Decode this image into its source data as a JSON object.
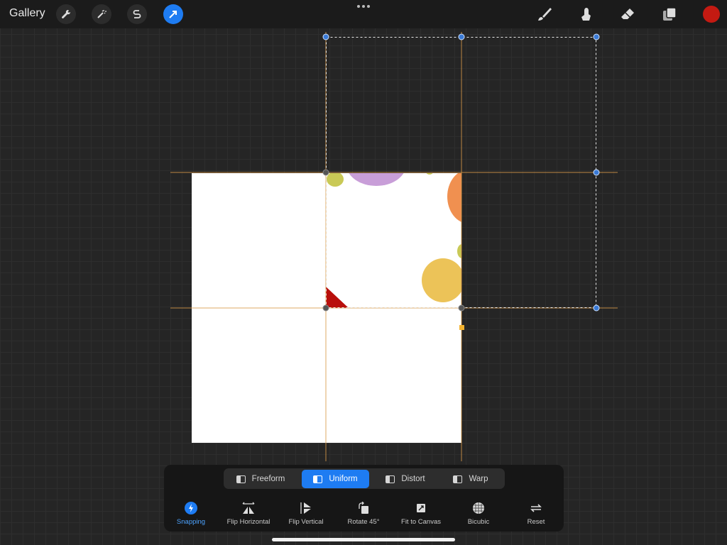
{
  "topbar": {
    "gallery_label": "Gallery",
    "left_tools": [
      {
        "name": "wrench-icon"
      },
      {
        "name": "magic-wand-icon"
      },
      {
        "name": "selection-s-icon"
      },
      {
        "name": "transform-arrow-icon",
        "active": true
      }
    ],
    "more_icon": "ellipsis-icon",
    "right_tools": [
      {
        "name": "brush-icon"
      },
      {
        "name": "smudge-icon"
      },
      {
        "name": "eraser-icon"
      },
      {
        "name": "layers-icon"
      }
    ],
    "current_color": "#c41a12"
  },
  "transform": {
    "modes": [
      {
        "label": "Freeform",
        "active": false
      },
      {
        "label": "Uniform",
        "active": true
      },
      {
        "label": "Distort",
        "active": false
      },
      {
        "label": "Warp",
        "active": false
      }
    ],
    "actions": [
      {
        "label": "Snapping",
        "active": true
      },
      {
        "label": "Flip Horizontal"
      },
      {
        "label": "Flip Vertical"
      },
      {
        "label": "Rotate 45°"
      },
      {
        "label": "Fit to Canvas"
      },
      {
        "label": "Bicubic"
      },
      {
        "label": "Reset"
      }
    ]
  },
  "colors": {
    "accent": "#1e7cf2",
    "guide": "#d89a48",
    "canvas": "#ffffff",
    "background": "#252525"
  }
}
